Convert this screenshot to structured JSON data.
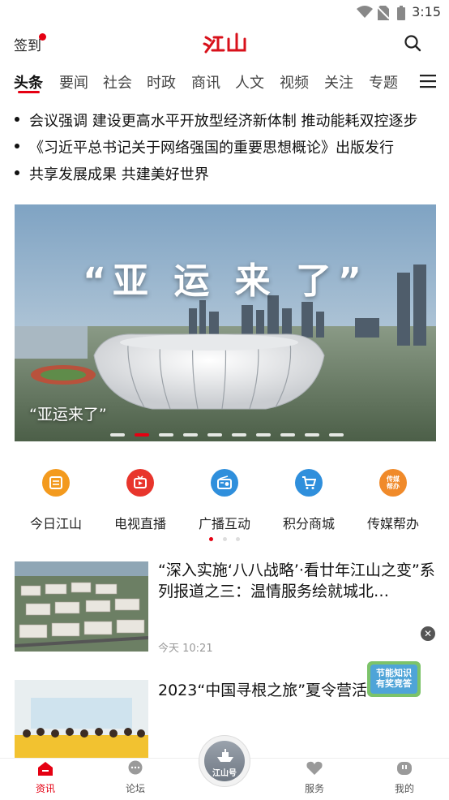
{
  "status_bar": {
    "time": "3:15"
  },
  "header": {
    "signin_label": "签到",
    "logo_text": "江山"
  },
  "tabs": [
    {
      "label": "头条",
      "active": true
    },
    {
      "label": "要闻"
    },
    {
      "label": "社会"
    },
    {
      "label": "时政"
    },
    {
      "label": "商讯"
    },
    {
      "label": "人文"
    },
    {
      "label": "视频"
    },
    {
      "label": "关注"
    },
    {
      "label": "专题"
    }
  ],
  "headlines": [
    "会议强调 建设更高水平开放型经济新体制 推动能耗双控逐步",
    "《习近平总书记关于网络强国的重要思想概论》出版发行",
    "共享发展成果 共建美好世界"
  ],
  "banner": {
    "title": "“亚 运 来 了”",
    "caption": "“亚运来了”",
    "page_count": 10,
    "active_page": 2
  },
  "quick_entries": [
    {
      "label": "今日江山",
      "icon": "newspaper-icon",
      "color": "#f39a1e"
    },
    {
      "label": "电视直播",
      "icon": "tv-icon",
      "color": "#e8352c"
    },
    {
      "label": "广播互动",
      "icon": "radio-icon",
      "color": "#2f8fdc"
    },
    {
      "label": "积分商城",
      "icon": "cart-icon",
      "color": "#2f8fdc"
    },
    {
      "label": "传媒帮办",
      "icon": "help-badge-icon",
      "color": "#f08a2a",
      "icon_text": "传媒帮办"
    }
  ],
  "quick_pager": {
    "count": 3,
    "active": 1
  },
  "news": [
    {
      "title": "“深入实施‘八八战略’·看廿年江山之变”系列报道之三：温情服务绘就城北…",
      "time": "今天 10:21"
    },
    {
      "title": "2023“中国寻根之旅”夏令营活动营营"
    }
  ],
  "ad_badge": {
    "line1": "节能知识",
    "line2": "有奖竞答"
  },
  "bottom_nav": [
    {
      "label": "资讯",
      "icon": "home-icon",
      "active": true
    },
    {
      "label": "论坛",
      "icon": "forum-icon"
    },
    {
      "label": "江山号",
      "icon": "ship-icon"
    },
    {
      "label": "服务",
      "icon": "heart-icon"
    },
    {
      "label": "我的",
      "icon": "profile-icon"
    }
  ],
  "colors": {
    "accent": "#e50012"
  }
}
